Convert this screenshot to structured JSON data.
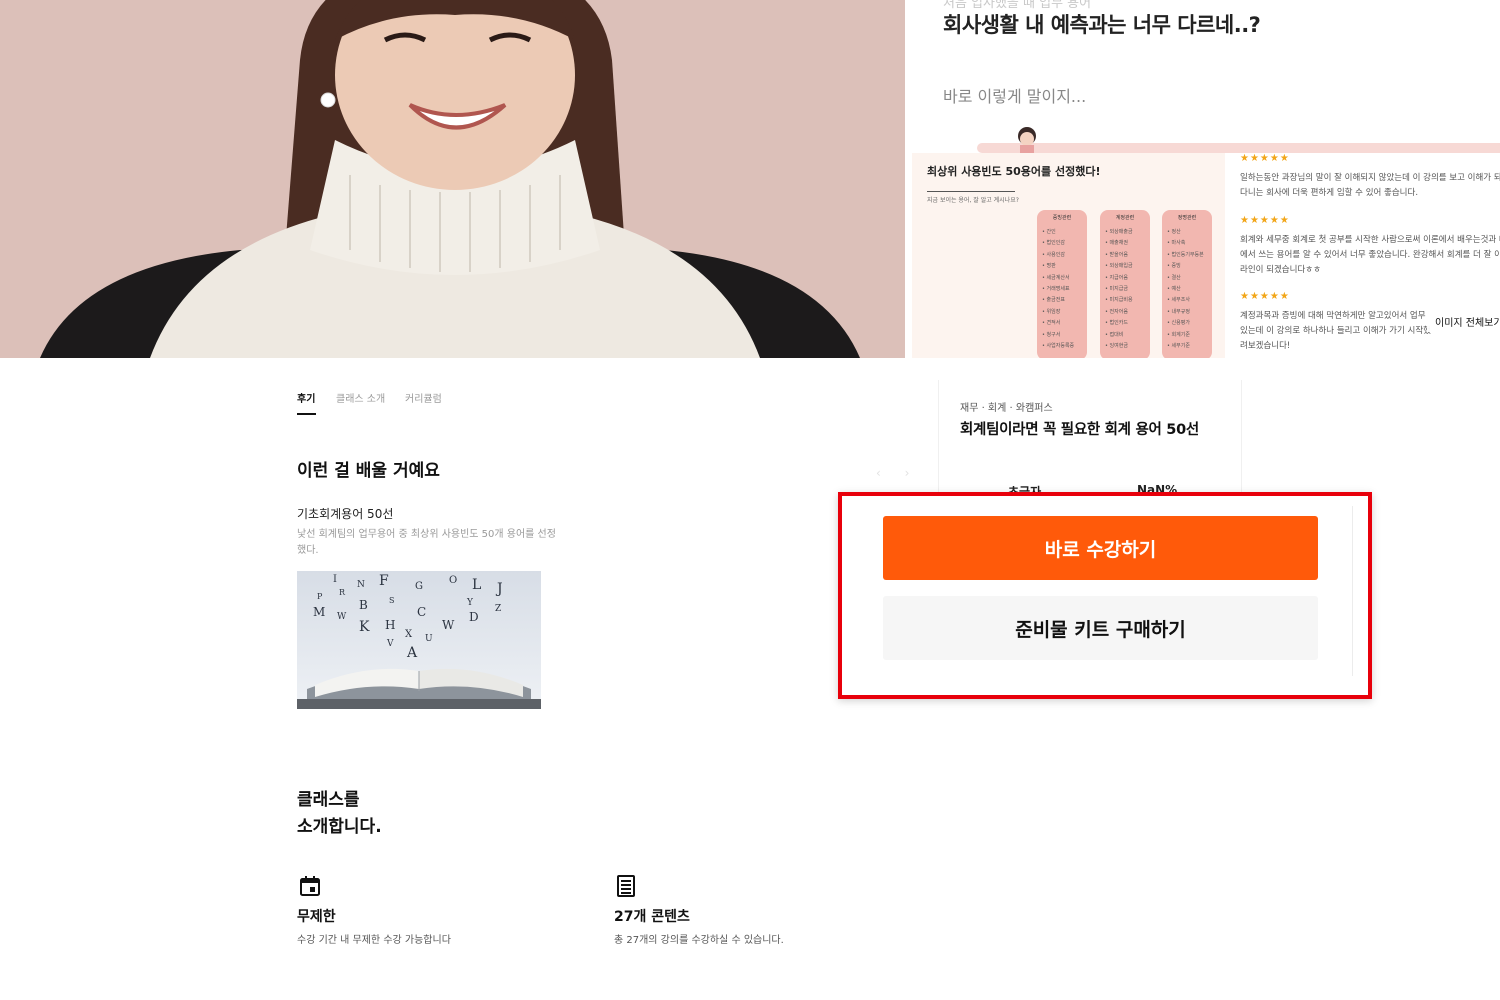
{
  "gallery": {
    "story_cut": "처음 입사했을 때 업무 용어",
    "story_headline": "회사생활 내 예측과는 너무 다르네..?",
    "story_sub": "바로 이렇게 말이지...",
    "vocab_title": "최상위 사용빈도 50용어를 선정했다!",
    "vocab_caption": "지금 보이는 용어, 잘 알고 계시나요?",
    "vocab_columns": [
      {
        "head": "증빙관련",
        "rows": [
          "• 간인",
          "• 법인인감",
          "• 사용인감",
          "• 명판",
          "• 세금계산서",
          "• 거래명세표",
          "• 출금전표",
          "• 위임장",
          "• 견적서",
          "• 청구서",
          "• 사업자등록증"
        ]
      },
      {
        "head": "계정관련",
        "rows": [
          "• 외상매출금",
          "• 매출채권",
          "• 받을어음",
          "• 외상매입금",
          "• 지급어음",
          "• 미지급금",
          "• 미지급비용",
          "• 전자어음",
          "• 법인카드",
          "• 접대비",
          "• 잉여현금"
        ]
      },
      {
        "head": "정명관련",
        "rows": [
          "• 정산",
          "• 마사축",
          "• 법인등기부등본",
          "• 증빙",
          "• 결산",
          "• 예산",
          "• 세무조사",
          "• 내부규정",
          "• 신용평가",
          "• 회계기준",
          "• 세무기준"
        ]
      }
    ],
    "reviews": [
      {
        "stars": "★★★★★",
        "lines": [
          "일하는동안 과장님의 말이 잘 이해되지 않았는데 이 강의를 보고 이해가 되",
          "다니는 회사에 더욱 편하게 임할 수 있어 좋습니다."
        ]
      },
      {
        "stars": "★★★★★",
        "lines": [
          "회계와 세무중 회계로 첫 공부를 시작한 사람으로써 이론에서 배우는것과 대",
          "에서 쓰는 용어를 알 수 있어서 너무 좋았습니다. 완강해서 회계를 더 잘 이해",
          "라인이 되겠습니다ㅎㅎ"
        ]
      },
      {
        "stars": "★★★★★",
        "lines": [
          "계정과목과 증빙에 대해 막연하게만 알고있어서 업무",
          "있는데 이 강의로 하나하나 들리고 이해가 가기 시작했",
          "려보겠습니다!"
        ]
      }
    ],
    "image_all_label": "이미지 전체보기"
  },
  "tabs": [
    {
      "label": "후기",
      "active": true
    },
    {
      "label": "클래스 소개",
      "active": false
    },
    {
      "label": "커리큘럼",
      "active": false
    }
  ],
  "learn": {
    "title": "이런 걸 배울 거예요",
    "item_title": "기초회계용어 50선",
    "item_desc": "낯선 회계팀의 업무용어 중 최상위 사용빈도 50개 용어를 선정했다."
  },
  "intro": {
    "title_line1": "클래스를",
    "title_line2": "소개합니다.",
    "features": [
      {
        "icon": "calendar-icon",
        "title": "무제한",
        "desc": "수강 기간 내 무제한 수강 가능합니다"
      },
      {
        "icon": "document-icon",
        "title": "27개 콘텐츠",
        "desc": "총 27개의 강의를 수강하실 수 있습니다."
      }
    ]
  },
  "card": {
    "category": "재무 · 회계 · 와캠퍼스",
    "title": "회계팀이라면 꼭 필요한 회계 용어 50선",
    "level": "초급자",
    "rate": "NaN%",
    "primary_button": "바로 수강하기",
    "secondary_button": "준비물 키트 구매하기"
  },
  "colors": {
    "accent_orange": "#ff5a0a",
    "highlight_red": "#e8000b",
    "hero_background": "#dbbfb8",
    "star_yellow": "#f2a619"
  }
}
